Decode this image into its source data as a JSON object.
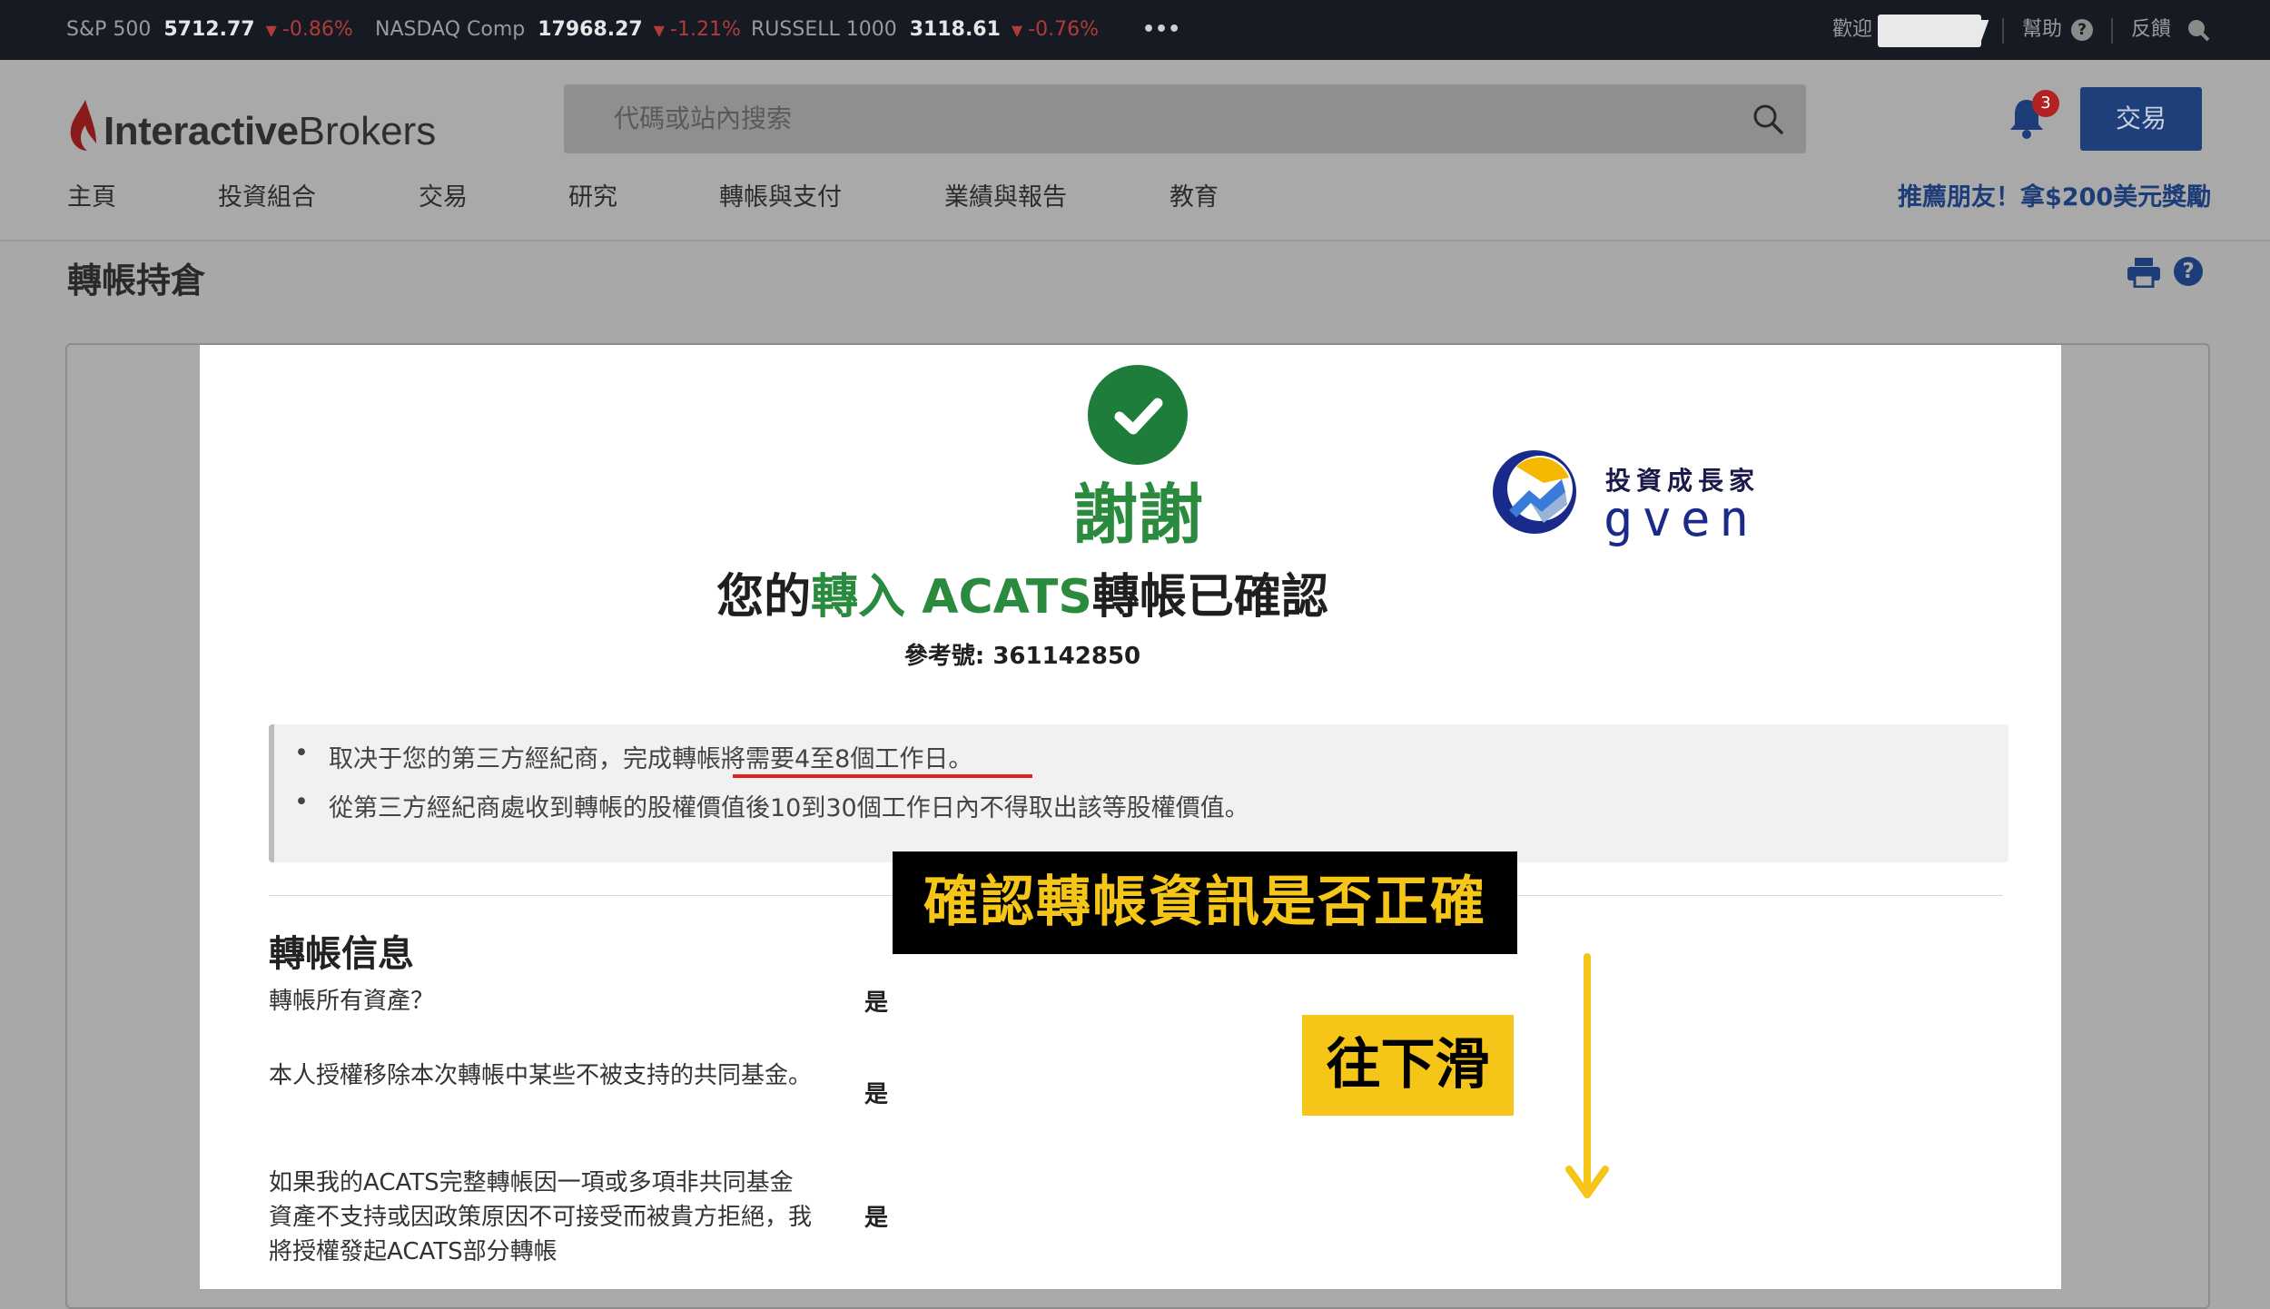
{
  "ticker": {
    "items": [
      {
        "name": "S&P 500",
        "value": "5712.77",
        "change": "-0.86%"
      },
      {
        "name": "NASDAQ Comp",
        "value": "17968.27",
        "change": "-1.21%"
      },
      {
        "name": "RUSSELL 1000",
        "value": "3118.61",
        "change": "-0.76%"
      }
    ],
    "more": "•••",
    "welcome": "歡迎",
    "help": "幫助",
    "feedback": "反饋"
  },
  "header": {
    "logo_bold": "Interactive",
    "logo_regular": "Brokers",
    "search_placeholder": "代碼或站內搜索",
    "notification_count": "3",
    "trade_button": "交易",
    "nav": [
      "主頁",
      "投資組合",
      "交易",
      "研究",
      "轉帳與支付",
      "業績與報告",
      "教育"
    ],
    "referral": "推薦朋友！拿$200美元獎勵"
  },
  "page": {
    "title": "轉帳持倉"
  },
  "confirmation": {
    "thanks": "謝謝",
    "line_prefix": "您的",
    "line_green": "轉入 ACATS",
    "line_suffix": "轉帳已確認",
    "reference_label": "參考號: ",
    "reference_number": "361142850",
    "notes": [
      "取决于您的第三方經紀商，完成轉帳將需要4至8個工作日。",
      "從第三方經紀商處收到轉帳的股權價值後10到30個工作日內不得取出該等股權價值。"
    ]
  },
  "transfer_info": {
    "title": "轉帳信息",
    "rows": [
      {
        "question": "轉帳所有資產？",
        "answer": "是"
      },
      {
        "question": "本人授權移除本次轉帳中某些不被支持的共同基金。",
        "answer": "是"
      },
      {
        "question": "如果我的ACATS完整轉帳因一項或多項非共同基金資產不支持或因政策原因不可接受而被貴方拒絕，我將授權發起ACATS部分轉帳",
        "answer": "是"
      }
    ]
  },
  "overlay": {
    "brand_line1": "投資成長家",
    "brand_line2": "GVEN",
    "callout_main": "確認轉帳資訊是否正確",
    "callout_scroll": "往下滑"
  },
  "colors": {
    "accent_green": "#2a8a3e",
    "brand_blue": "#1f3f7a",
    "negative_red": "#b23a3a",
    "callout_yellow": "#f5c518"
  }
}
